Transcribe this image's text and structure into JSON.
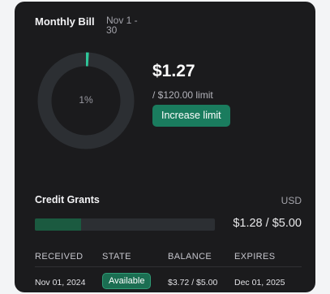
{
  "header": {
    "title": "Monthly Bill",
    "date_range": "Nov 1 - 30"
  },
  "usage": {
    "percent_label": "1%",
    "percent_value": 1,
    "amount": "$1.27",
    "limit": "/ $120.00 limit",
    "increase_button": "Increase limit"
  },
  "credit_grants": {
    "title": "Credit Grants",
    "currency": "USD",
    "used": "$1.28 / $5.00",
    "used_fraction": 0.256,
    "columns": {
      "received": "RECEIVED",
      "state": "STATE",
      "balance": "BALANCE",
      "expires": "EXPIRES"
    },
    "rows": [
      {
        "received": "Nov 01, 2024",
        "state": "Available",
        "balance": "$3.72 / $5.00",
        "expires": "Dec 01, 2025"
      }
    ]
  },
  "colors": {
    "card_background": "#1b1b1d",
    "accent_green": "#1a7c5e",
    "ring_progress": "#2fc79a",
    "ring_track": "#2c2f33",
    "bar_fill": "#1b5a40"
  }
}
